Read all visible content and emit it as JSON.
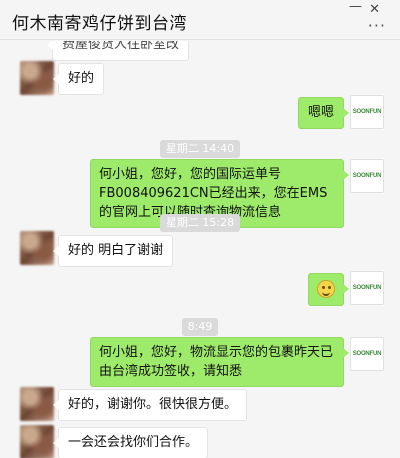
{
  "window": {
    "title": "何木南寄鸡仔饼到台湾",
    "minimize_glyph": "—",
    "close_glyph": "✕",
    "more_glyph": "···"
  },
  "contact_avatar_label": "blurred-contact-photo",
  "self_avatar_label": "SOONFUN",
  "messages": {
    "m0": "费屋俊货人往卧室改",
    "m1": "好的",
    "m2": "嗯嗯",
    "ts1": "星期二 14:40",
    "m3": "何小姐，您好，您的国际运单号FB008409621CN已经出来，您在EMS的官网上可以随时查询物流信息",
    "ts2": "星期二 15:28",
    "m4": "好的 明白了谢谢",
    "m5_icon": "smile-emoji",
    "ts3": "8:49",
    "m6": "何小姐，您好，物流显示您的包裹昨天已由台湾成功签收，请知悉",
    "m7": "好的，谢谢你。很快很方便。",
    "m8": "一会还会找你们合作。"
  }
}
